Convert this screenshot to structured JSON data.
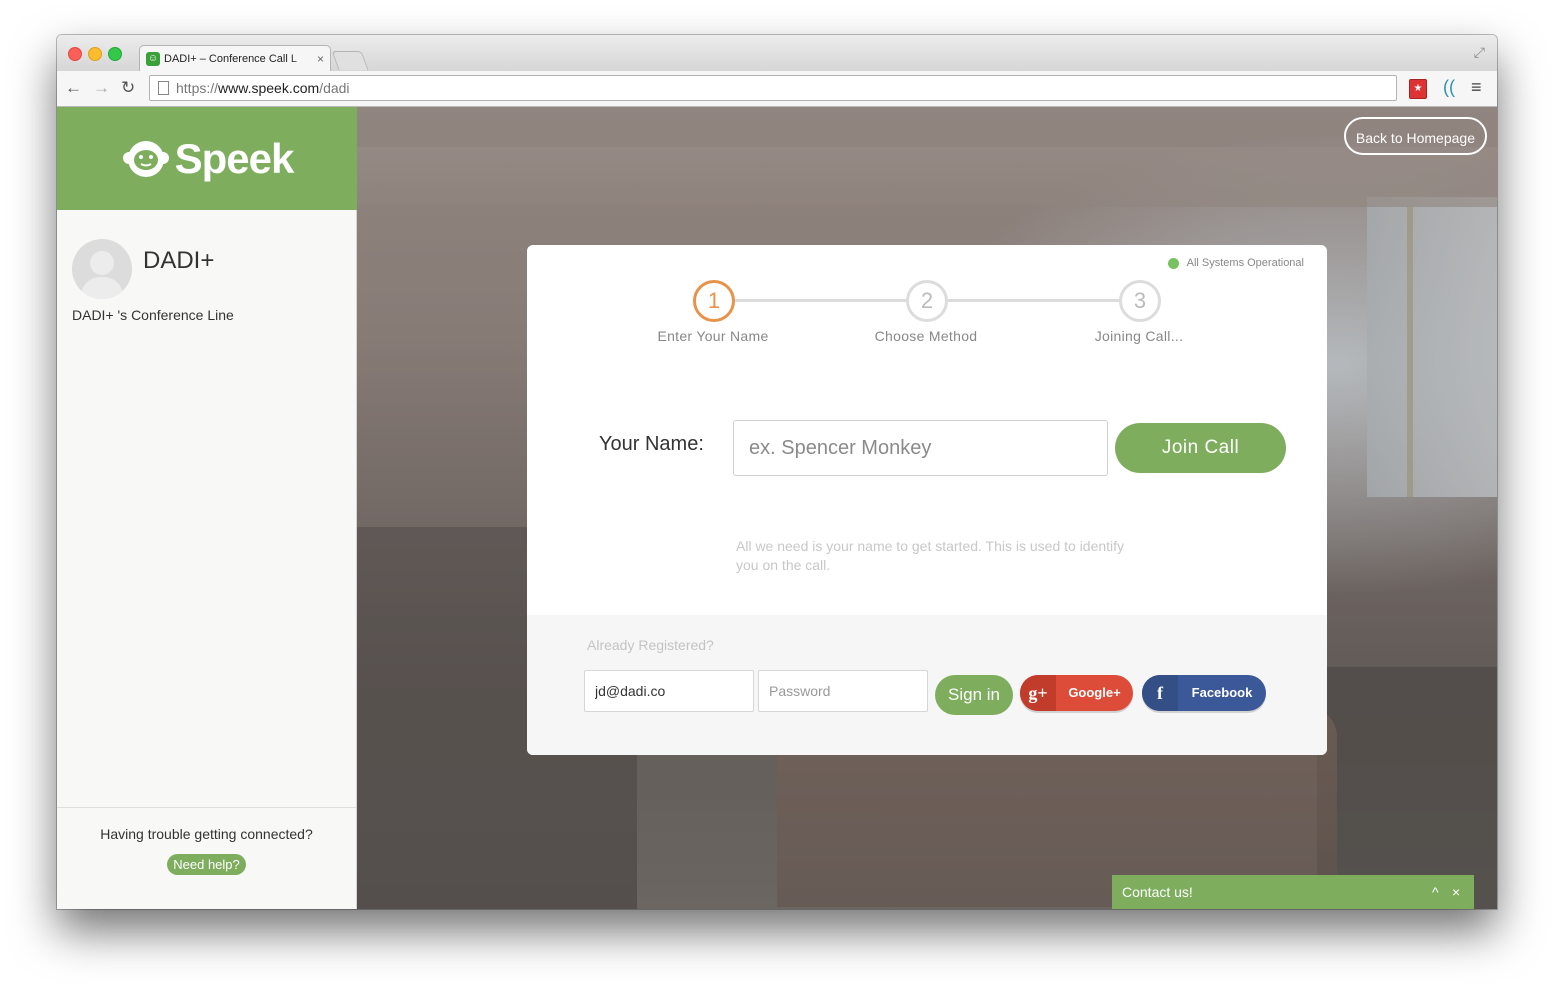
{
  "browser": {
    "tab_title": "DADI+ – Conference Call L",
    "tab_close": "×",
    "url_scheme": "https://",
    "url_host": "www.speek.com",
    "url_path": "/dadi",
    "icons": [
      "back-arrow-icon",
      "forward-arrow-icon",
      "reload-icon",
      "page-icon",
      "fullscreen-icon",
      "menu-icon"
    ]
  },
  "sidebar": {
    "brand": "Speek",
    "conference_name": "DADI+",
    "conference_line": "DADI+ 's Conference Line",
    "help_text": "Having trouble getting connected?",
    "help_button": "Need help?"
  },
  "header": {
    "back_button": "Back to Homepage"
  },
  "card": {
    "status": "All Systems Operational",
    "steps": [
      {
        "num": "1",
        "label": "Enter Your Name"
      },
      {
        "num": "2",
        "label": "Choose Method"
      },
      {
        "num": "3",
        "label": "Joining Call..."
      }
    ],
    "name_label": "Your Name:",
    "name_placeholder": "ex. Spencer Monkey",
    "join_button": "Join Call",
    "hint": "All we need is your name to get started. This is used to identify you on the call.",
    "footer": {
      "already_registered": "Already Registered?",
      "email_value": "jd@dadi.co",
      "password_placeholder": "Password",
      "signin_button": "Sign in",
      "google_label": "Google+",
      "google_icon_text": "g+",
      "facebook_label": "Facebook",
      "facebook_icon_text": "f"
    }
  },
  "contact": {
    "label": "Contact us!",
    "expand_icon": "^",
    "close_icon": "×"
  },
  "colors": {
    "brand_green": "#7eae5d",
    "step_active": "#e8934b",
    "status_ok": "#78c160",
    "google_red": "#dd4b39",
    "facebook_blue": "#3b5998"
  }
}
